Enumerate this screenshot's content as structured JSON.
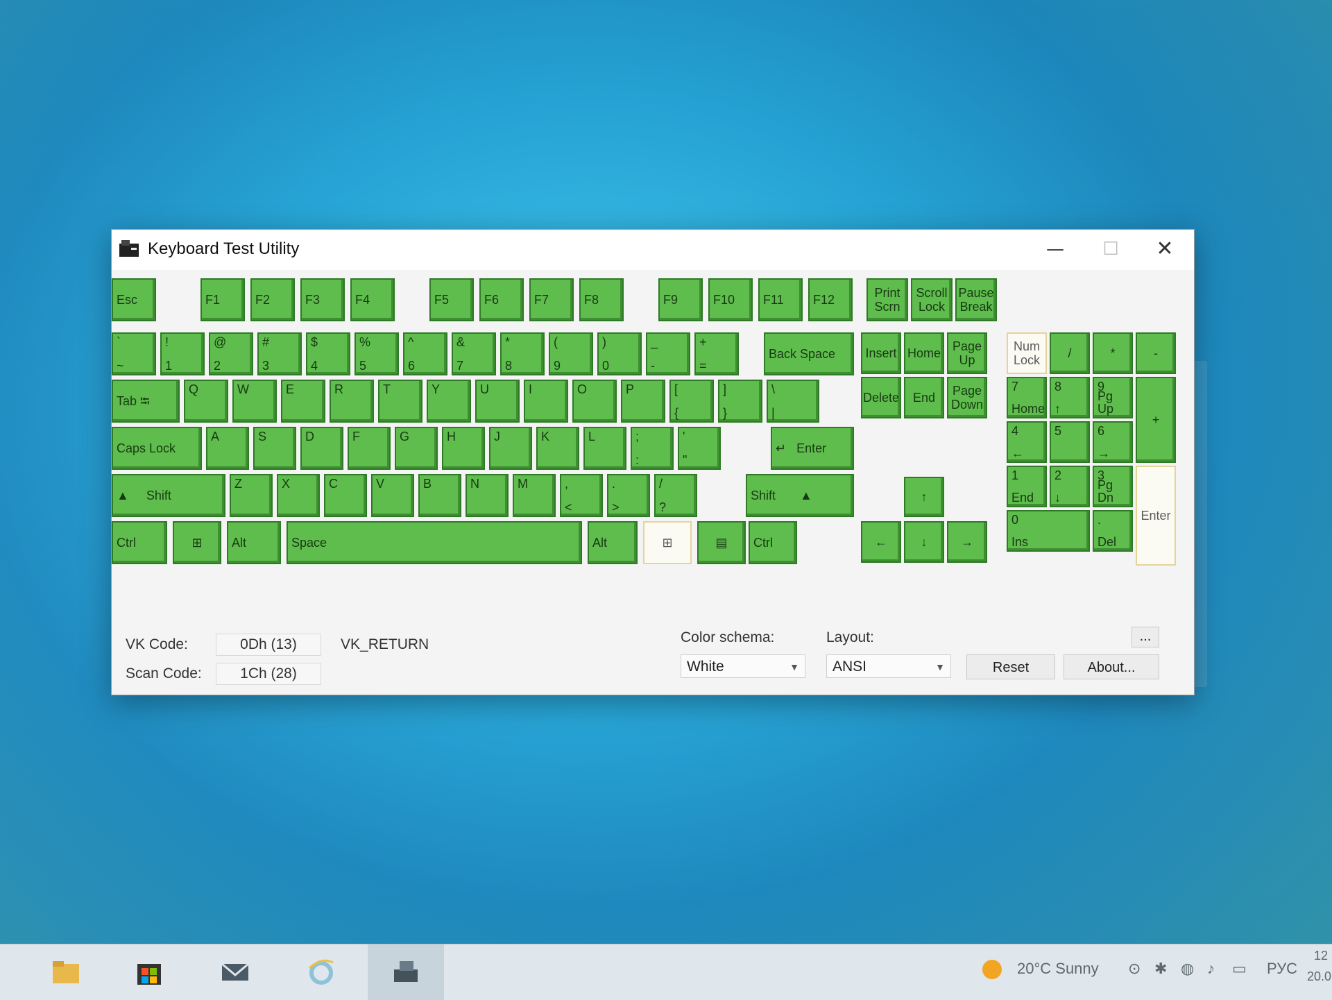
{
  "window": {
    "title": "Keyboard Test Utility",
    "controls": {
      "minimize": "—",
      "maximize": "☐",
      "close": "✕"
    }
  },
  "keys": {
    "esc": "Esc",
    "f1": "F1",
    "f2": "F2",
    "f3": "F3",
    "f4": "F4",
    "f5": "F5",
    "f6": "F6",
    "f7": "F7",
    "f8": "F8",
    "f9": "F9",
    "f10": "F10",
    "f11": "F11",
    "f12": "F12",
    "print_top": "Print",
    "print_bot": "Scrn",
    "scroll_top": "Scroll",
    "scroll_bot": "Lock",
    "pause_top": "Pause",
    "pause_bot": "Break",
    "digits_top": [
      "`",
      "!",
      "@",
      "#",
      "$",
      "%",
      "^",
      "&",
      "*",
      "(",
      ")",
      "_",
      "+"
    ],
    "digits_bot": [
      "~",
      "1",
      "2",
      "3",
      "4",
      "5",
      "6",
      "7",
      "8",
      "9",
      "0",
      "-",
      "="
    ],
    "backspace": "Back Space",
    "tab": "Tab",
    "tab_glyph": "⭾",
    "row_q": [
      "Q",
      "W",
      "E",
      "R",
      "T",
      "Y",
      "U",
      "I",
      "O",
      "P"
    ],
    "bracket_top": [
      "[",
      "]",
      "\\"
    ],
    "bracket_bot": [
      "{",
      "}",
      "|"
    ],
    "capslock": "Caps Lock",
    "row_a": [
      "A",
      "S",
      "D",
      "F",
      "G",
      "H",
      "J",
      "K",
      "L"
    ],
    "semi_top": [
      ";",
      "'"
    ],
    "semi_bot": [
      ":",
      "\""
    ],
    "enter_glyph": "↵",
    "enter": "Enter",
    "shift_glyph": "▲",
    "shift": "Shift",
    "row_z": [
      "Z",
      "X",
      "C",
      "V",
      "B",
      "N",
      "M"
    ],
    "comma_top": [
      ",",
      ".",
      "/"
    ],
    "comma_bot": [
      "<",
      ">",
      "?"
    ],
    "ctrl": "Ctrl",
    "alt": "Alt",
    "space": "Space",
    "win_glyph": "⊞",
    "menu_glyph": "▤",
    "insert": "Insert",
    "home": "Home",
    "pageup_top": "Page",
    "pageup_bot": "Up",
    "delete": "Delete",
    "end": "End",
    "pagedown_top": "Page",
    "pagedown_bot": "Down",
    "arrow_up": "↑",
    "arrow_left": "←",
    "arrow_down": "↓",
    "arrow_right": "→",
    "numlock_top": "Num",
    "numlock_bot": "Lock",
    "np_div": "/",
    "np_mul": "*",
    "np_minus": "-",
    "np_plus": "+",
    "np7_top": "7",
    "np7_bot": "Home",
    "np8_top": "8",
    "np8_bot": "↑",
    "np9_top": "9",
    "np9_bot": "Pg Up",
    "np4_top": "4",
    "np4_bot": "←",
    "np5_top": "5",
    "np6_top": "6",
    "np6_bot": "→",
    "np1_top": "1",
    "np1_bot": "End",
    "np2_top": "2",
    "np2_bot": "↓",
    "np3_top": "3",
    "np3_bot": "Pg Dn",
    "np0_top": "0",
    "np0_bot": "Ins",
    "npdot_top": ".",
    "npdot_bot": "Del",
    "np_enter": "Enter"
  },
  "info": {
    "vk_label": "VK Code:",
    "vk_value": "0Dh (13)",
    "vk_name": "VK_RETURN",
    "scan_label": "Scan Code:",
    "scan_value": "1Ch (28)"
  },
  "settings": {
    "color_label": "Color schema:",
    "color_value": "White",
    "layout_label": "Layout:",
    "layout_value": "ANSI",
    "more_button": "...",
    "reset_button": "Reset",
    "about_button": "About..."
  },
  "taskbar": {
    "weather": "20°C  Sunny",
    "language": "РУС",
    "clock_top": "12",
    "clock_bot": "20.0"
  },
  "colors": {
    "key_pressed": "#5fbd4d",
    "key_unpressed": "#fbfbf4",
    "desktop": "#1ea8dd"
  }
}
